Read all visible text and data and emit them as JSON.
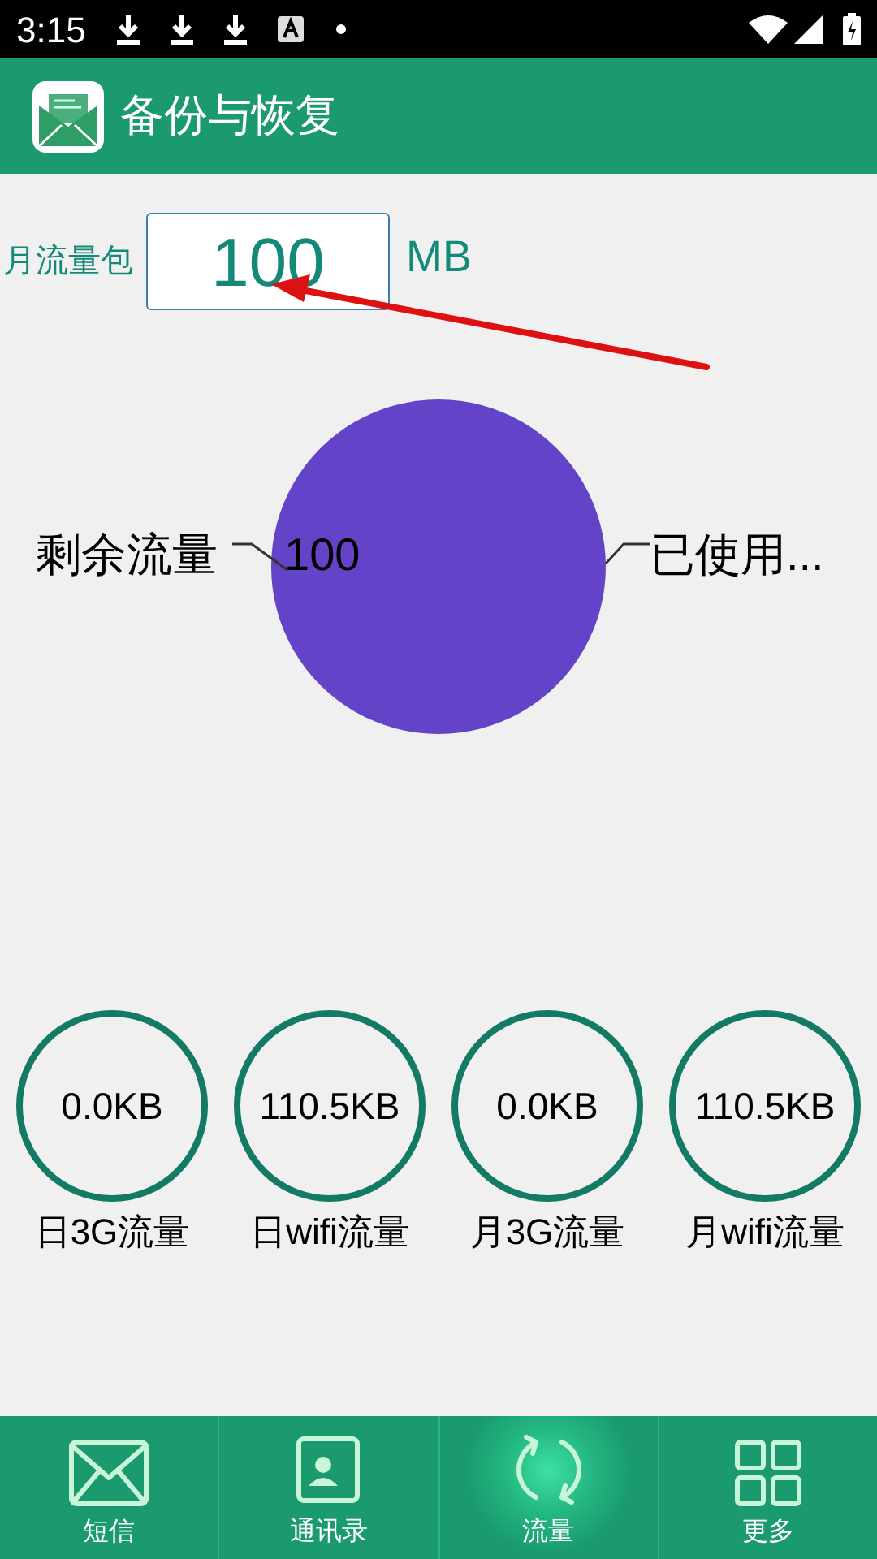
{
  "status_bar": {
    "time": "3:15"
  },
  "header": {
    "title": "备份与恢复"
  },
  "quota": {
    "label": "月流量包",
    "value": "100",
    "unit": "MB"
  },
  "chart_data": {
    "type": "pie",
    "categories": [
      "剩余流量",
      "已使用..."
    ],
    "values": [
      100,
      0
    ],
    "value_labels": [
      "100",
      null
    ]
  },
  "stats": [
    {
      "value": "0.0KB",
      "label": "日3G流量"
    },
    {
      "value": "110.5KB",
      "label": "日wifi流量"
    },
    {
      "value": "0.0KB",
      "label": "月3G流量"
    },
    {
      "value": "110.5KB",
      "label": "月wifi流量"
    }
  ],
  "tabs": [
    {
      "kind": "sms",
      "label": "短信",
      "selected": false
    },
    {
      "kind": "contacts",
      "label": "通讯录",
      "selected": false
    },
    {
      "kind": "traffic",
      "label": "流量",
      "selected": true
    },
    {
      "kind": "more",
      "label": "更多",
      "selected": false
    }
  ]
}
